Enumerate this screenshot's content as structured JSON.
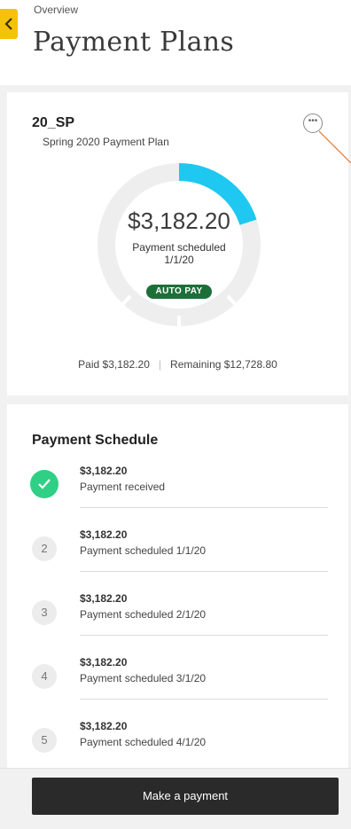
{
  "header": {
    "breadcrumb": "Overview",
    "title": "Payment Plans"
  },
  "plan": {
    "code": "20_SP",
    "name": "Spring 2020 Payment Plan",
    "amount": "$3,182.20",
    "status_line": "Payment scheduled",
    "status_date": "1/1/20",
    "autopay_label": "AUTO PAY",
    "paid_label": "Paid $3,182.20",
    "remaining_label": "Remaining $12,728.80",
    "progress_fraction": 0.2
  },
  "schedule": {
    "title": "Payment Schedule",
    "items": [
      {
        "marker": "",
        "amount": "$3,182.20",
        "status": "Payment received",
        "done": true
      },
      {
        "marker": "2",
        "amount": "$3,182.20",
        "status": "Payment scheduled 1/1/20",
        "done": false
      },
      {
        "marker": "3",
        "amount": "$3,182.20",
        "status": "Payment scheduled 2/1/20",
        "done": false
      },
      {
        "marker": "4",
        "amount": "$3,182.20",
        "status": "Payment scheduled 3/1/20",
        "done": false
      },
      {
        "marker": "5",
        "amount": "$3,182.20",
        "status": "Payment scheduled 4/1/20",
        "done": false
      }
    ]
  },
  "footer": {
    "button_label": "Make a payment"
  },
  "icons": {
    "back": "chevron-left-icon",
    "more": "more-options-icon",
    "check": "checkmark-icon"
  },
  "colors": {
    "accent_yellow": "#f5c20a",
    "progress_cyan": "#1ec8f0",
    "ring_gray": "#eeeeee",
    "autopay_green": "#1d6f3a",
    "received_green": "#2fcf86",
    "button_dark": "#2a2a2a"
  }
}
